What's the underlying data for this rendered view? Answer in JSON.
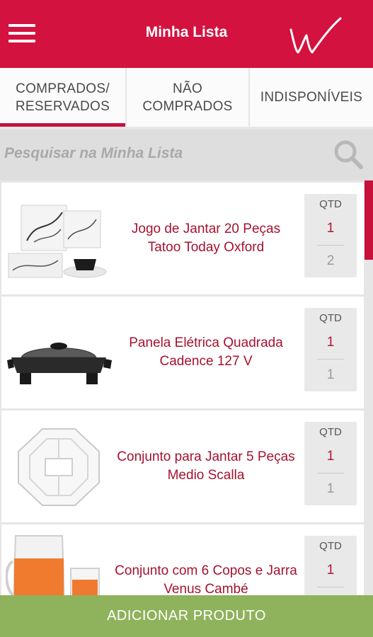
{
  "header": {
    "title": "Minha Lista",
    "menu_icon": "hamburger-menu-icon",
    "logo_icon": "brand-signature-logo"
  },
  "tabs": [
    {
      "label": "COMPRADOS/\nRESERVADOS",
      "active": true
    },
    {
      "label": "NÃO\nCOMPRADOS",
      "active": false
    },
    {
      "label": "INDISPONÍVEIS",
      "active": false
    }
  ],
  "search": {
    "placeholder": "Pesquisar na Minha Lista",
    "value": "",
    "icon": "search-icon"
  },
  "products": [
    {
      "name": "Jogo de Jantar 20 Peças Tatoo Today Oxford",
      "qty_label": "QTD",
      "qty_wanted": "1",
      "qty_bought": "2"
    },
    {
      "name": "Panela Elétrica Quadrada Cadence 127 V",
      "qty_label": "QTD",
      "qty_wanted": "1",
      "qty_bought": "1"
    },
    {
      "name": "Conjunto para Jantar 5 Peças Medio Scalla",
      "qty_label": "QTD",
      "qty_wanted": "1",
      "qty_bought": "1"
    },
    {
      "name": "Conjunto com 6 Copos e Jarra Venus Cambé",
      "qty_label": "QTD",
      "qty_wanted": "1",
      "qty_bought": ""
    }
  ],
  "footer": {
    "add_button_label": "ADICIONAR PRODUTO"
  },
  "colors": {
    "brand_red": "#d3123f",
    "product_text": "#a5122f",
    "add_button_green": "#8fb25c"
  }
}
